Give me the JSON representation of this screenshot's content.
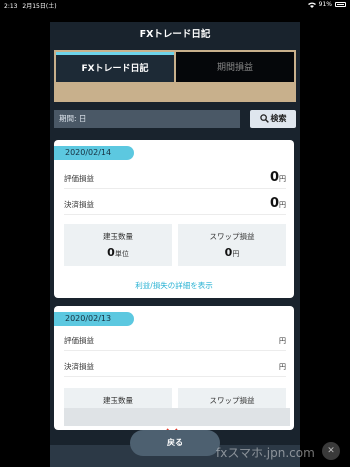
{
  "status_bar": {
    "time": "2:13",
    "date": "2月15日(土)",
    "battery": "91%"
  },
  "header": {
    "title": "FXトレード日記"
  },
  "tabs": [
    {
      "label": "FXトレード日記"
    },
    {
      "label": "期間損益"
    }
  ],
  "search": {
    "period_value": "期間: 日",
    "button_label": "検索"
  },
  "entries": [
    {
      "date": "2020/02/14",
      "rows": [
        {
          "label": "評価損益",
          "value": "0",
          "unit": "円"
        },
        {
          "label": "決済損益",
          "value": "0",
          "unit": "円"
        }
      ],
      "boxes": [
        {
          "title": "建玉数量",
          "value": "0",
          "unit": "単位"
        },
        {
          "title": "スワップ損益",
          "value": "0",
          "unit": "円"
        }
      ],
      "link": "利益/損失の詳細を表示"
    },
    {
      "date": "2020/02/13",
      "rows": [
        {
          "label": "評価損益",
          "value": "",
          "unit": "円"
        },
        {
          "label": "決済損益",
          "value": "",
          "unit": "円"
        }
      ],
      "boxes": [
        {
          "title": "建玉数量"
        },
        {
          "title": "スワップ損益"
        }
      ]
    }
  ],
  "footer": {
    "back_label": "戻る"
  },
  "watermark": "fxスマホ.jpn.com",
  "icons": {
    "search": "search-icon",
    "expand": "chevron-down-icon",
    "close": "close-icon"
  },
  "colors": {
    "accent": "#5cc8e0",
    "link": "#2bb3d4",
    "tab_border": "#c8b08c",
    "background": "#19232d",
    "expand_chevron": "#e0392b"
  }
}
